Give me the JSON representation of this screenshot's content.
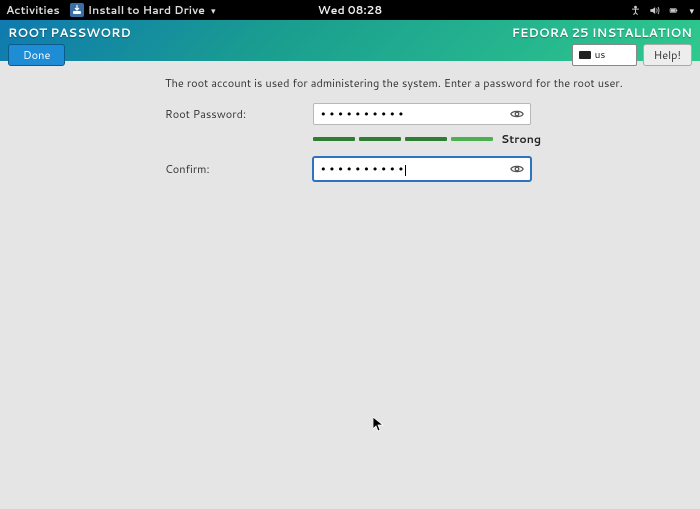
{
  "gnome": {
    "activities": "Activities",
    "app_name": "Install to Hard Drive",
    "clock": "Wed 08:28"
  },
  "header": {
    "screen_title": "ROOT PASSWORD",
    "done": "Done",
    "installer_title": "FEDORA 25 INSTALLATION",
    "keyboard": "us",
    "help": "Help!"
  },
  "form": {
    "intro": "The root account is used for administering the system.  Enter a password for the root user.",
    "password_label": "Root Password:",
    "confirm_label": "Confirm:",
    "password_mask": "••••••••••",
    "confirm_mask": "••••••••••",
    "strength_label": "Strong"
  }
}
